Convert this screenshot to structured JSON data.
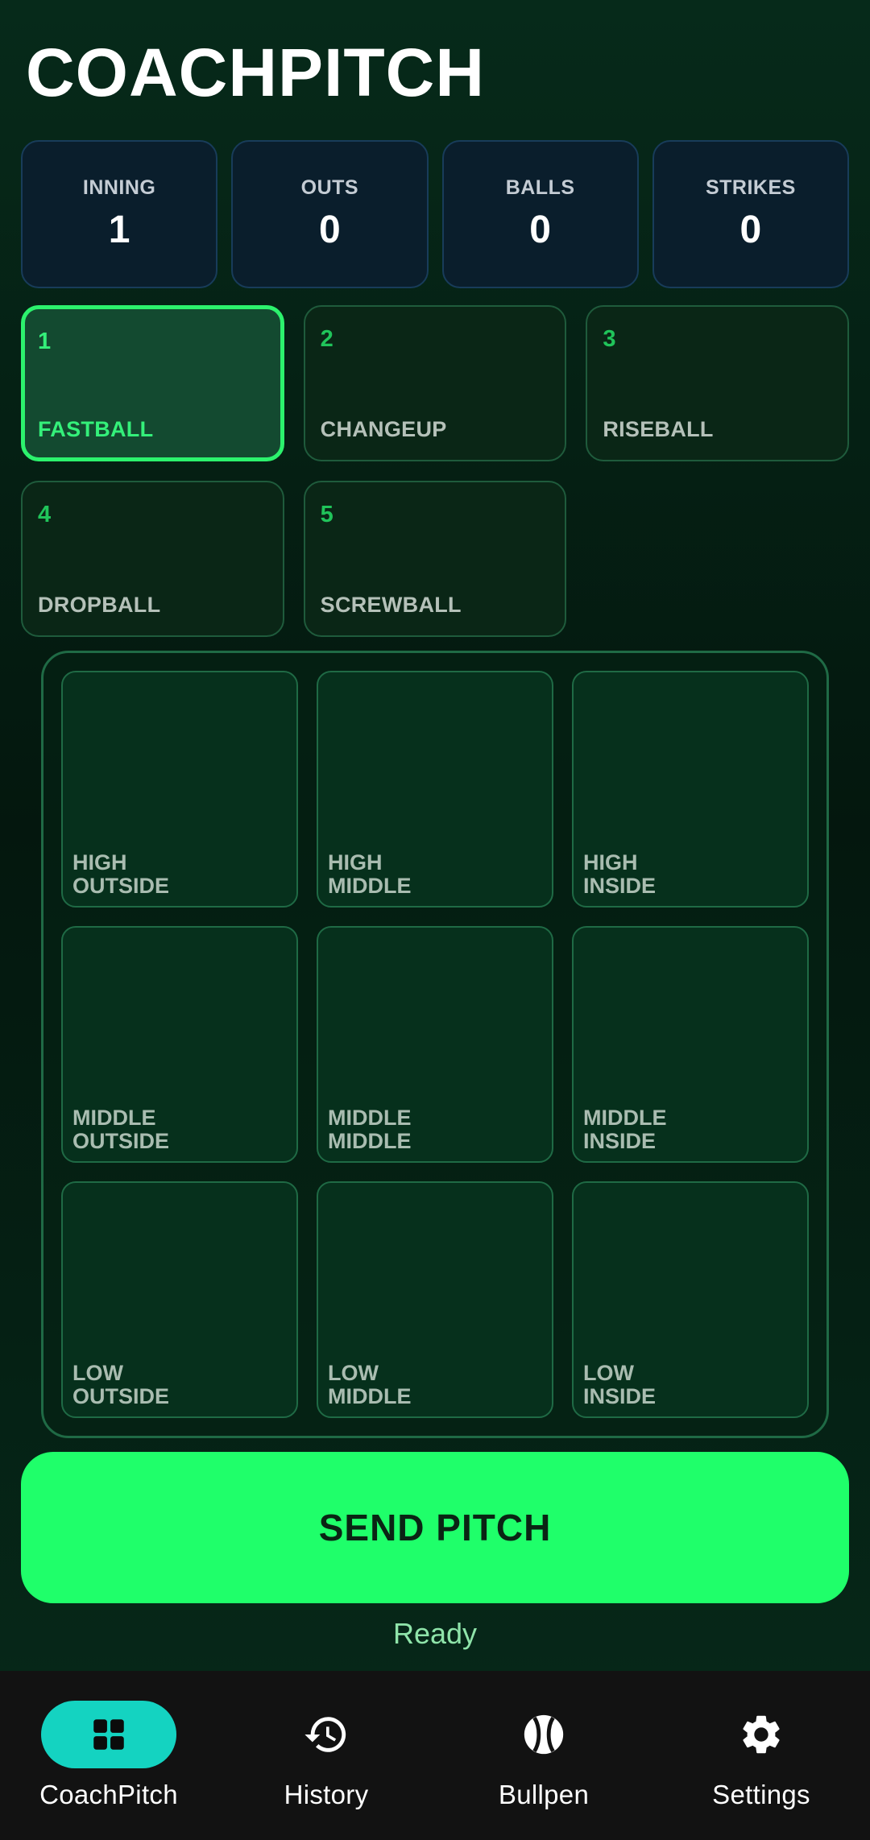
{
  "app": {
    "title": "COACHPITCH"
  },
  "counters": [
    {
      "label": "INNING",
      "value": "1"
    },
    {
      "label": "OUTS",
      "value": "0"
    },
    {
      "label": "BALLS",
      "value": "0"
    },
    {
      "label": "STRIKES",
      "value": "0"
    }
  ],
  "pitches": [
    {
      "num": "1",
      "name": "FASTBALL",
      "selected": true
    },
    {
      "num": "2",
      "name": "CHANGEUP",
      "selected": false
    },
    {
      "num": "3",
      "name": "RISEBALL",
      "selected": false
    },
    {
      "num": "4",
      "name": "DROPBALL",
      "selected": false
    },
    {
      "num": "5",
      "name": "SCREWBALL",
      "selected": false
    }
  ],
  "zone": [
    {
      "line1": "HIGH",
      "line2": "OUTSIDE"
    },
    {
      "line1": "HIGH",
      "line2": "MIDDLE"
    },
    {
      "line1": "HIGH",
      "line2": "INSIDE"
    },
    {
      "line1": "MIDDLE",
      "line2": "OUTSIDE"
    },
    {
      "line1": "MIDDLE",
      "line2": "MIDDLE"
    },
    {
      "line1": "MIDDLE",
      "line2": "INSIDE"
    },
    {
      "line1": "LOW",
      "line2": "OUTSIDE"
    },
    {
      "line1": "LOW",
      "line2": "MIDDLE"
    },
    {
      "line1": "LOW",
      "line2": "INSIDE"
    }
  ],
  "send": {
    "label": "SEND PITCH",
    "status": "Ready"
  },
  "nav": [
    {
      "label": "CoachPitch",
      "icon": "grid-icon",
      "active": true
    },
    {
      "label": "History",
      "icon": "history-icon",
      "active": false
    },
    {
      "label": "Bullpen",
      "icon": "ball-icon",
      "active": false
    },
    {
      "label": "Settings",
      "icon": "gear-icon",
      "active": false
    }
  ],
  "colors": {
    "accent": "#1fff6a",
    "nav_active": "#14d3c1",
    "selected_border": "#2cf26d"
  }
}
